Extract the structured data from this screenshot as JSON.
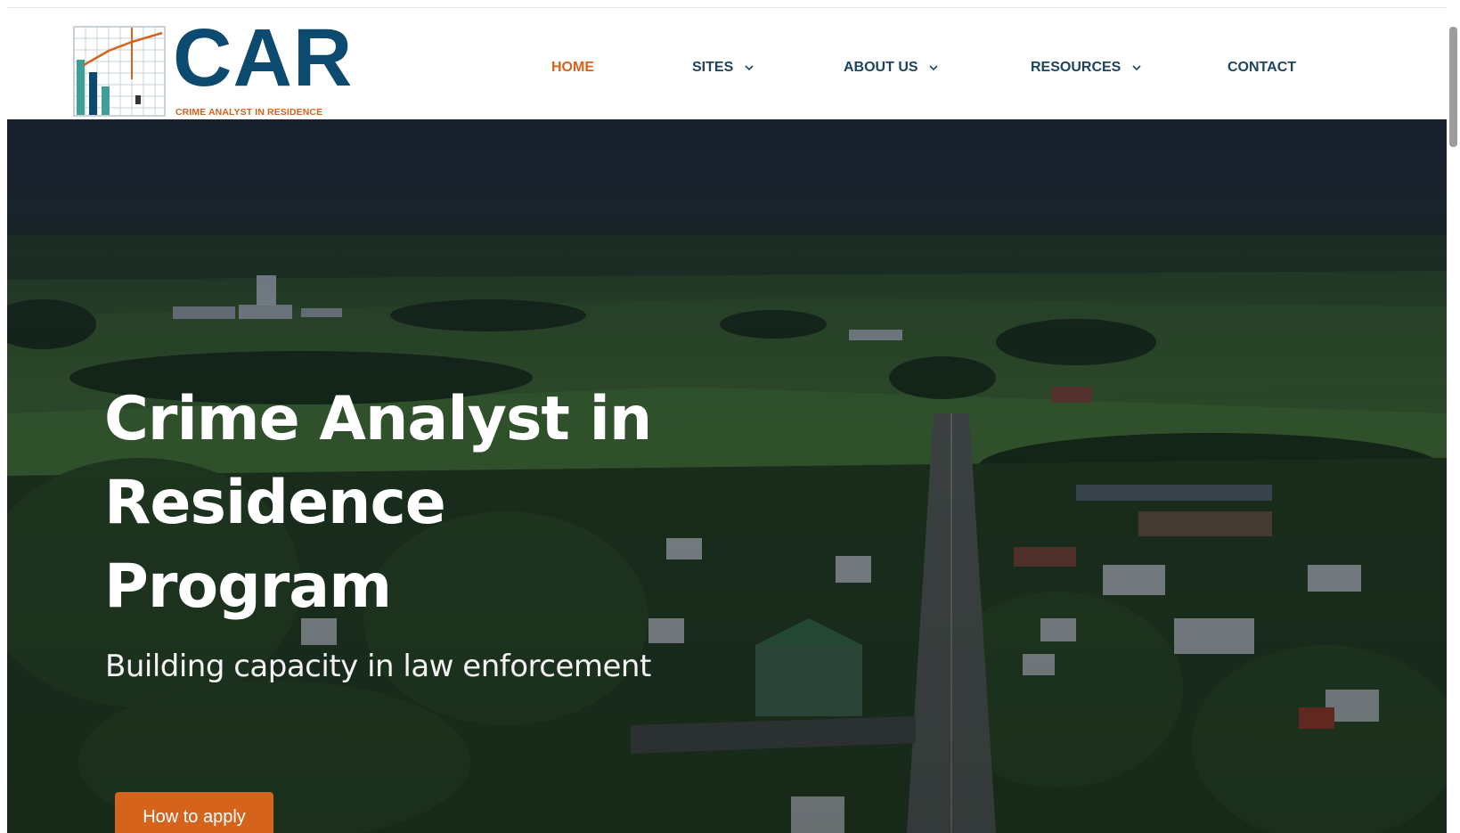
{
  "header": {
    "logo_title": "CAR",
    "logo_tagline": "CRIME ANALYST IN RESIDENCE"
  },
  "nav": {
    "items": [
      {
        "label": "HOME",
        "active": true,
        "has_dropdown": false
      },
      {
        "label": "SITES",
        "active": false,
        "has_dropdown": true
      },
      {
        "label": "ABOUT US",
        "active": false,
        "has_dropdown": true
      },
      {
        "label": "RESOURCES",
        "active": false,
        "has_dropdown": true
      },
      {
        "label": "CONTACT",
        "active": false,
        "has_dropdown": false
      }
    ]
  },
  "hero": {
    "title_lines": [
      "Crime Analyst in",
      "Residence",
      "Program"
    ],
    "subtitle": "Building capacity in law enforcement",
    "cta_label": "How to apply"
  },
  "colors": {
    "brand_navy": "#0d4a6f",
    "brand_orange": "#d5631c",
    "nav_text": "#1e4460"
  },
  "icons": {
    "dropdown": "chevron-down-icon",
    "logo_mark": "bar-chart-grid-logo"
  }
}
